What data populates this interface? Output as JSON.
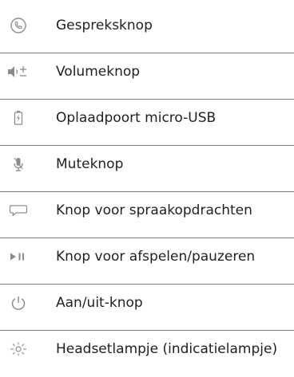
{
  "colors": {
    "icon": "#8c8c8c",
    "text": "#1f1f1f",
    "divider": "#7d7d7d"
  },
  "items": [
    {
      "icon": "phone-icon",
      "label": "Gespreksknop"
    },
    {
      "icon": "volume-icon",
      "label": "Volumeknop"
    },
    {
      "icon": "battery-charging-icon",
      "label": "Oplaadpoort micro-USB"
    },
    {
      "icon": "microphone-mute-icon",
      "label": "Muteknop"
    },
    {
      "icon": "speech-bubble-icon",
      "label": "Knop voor spraakopdrachten"
    },
    {
      "icon": "play-pause-icon",
      "label": "Knop voor afspelen/pauzeren"
    },
    {
      "icon": "power-icon",
      "label": "Aan/uit-knop"
    },
    {
      "icon": "indicator-light-icon",
      "label": "Headsetlampje (indicatielampje)"
    }
  ]
}
